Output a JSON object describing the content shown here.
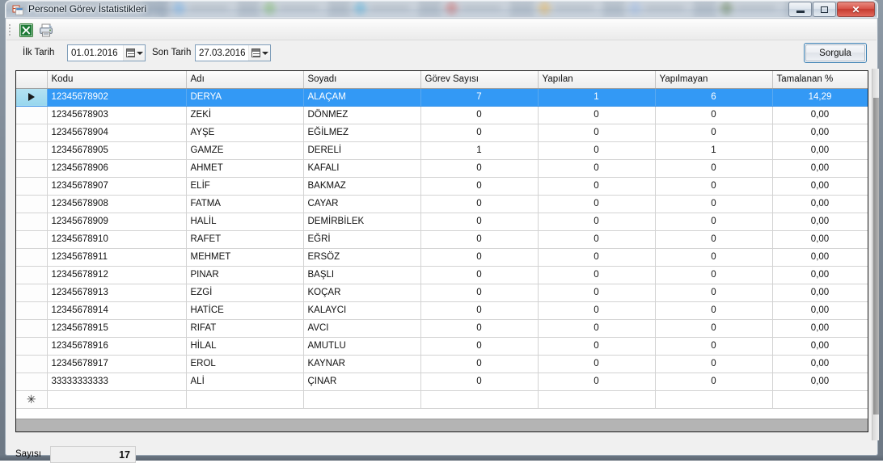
{
  "window": {
    "title": "Personel Görev İstatistikleri",
    "icon": "form-window-icon",
    "buttons": {
      "minimize": "minimize-button",
      "maximize": "maximize-button",
      "close_label": "✕"
    }
  },
  "toolbar": {
    "items": [
      {
        "name": "export-excel-icon",
        "tooltip": "Excel"
      },
      {
        "name": "print-icon",
        "tooltip": "Yazdır"
      }
    ]
  },
  "filter": {
    "start_label": "İlk Tarih",
    "start_value": "01.01.2016",
    "end_label": "Son Tarih",
    "end_value": "27.03.2016",
    "query_button": "Sorgula"
  },
  "grid": {
    "columns": [
      "Kodu",
      "Adı",
      "Soyadı",
      "Görev Sayısı",
      "Yapılan",
      "Yapılmayan",
      "Tamalanan %"
    ],
    "new_row_glyph": "✳",
    "selected_index": 0,
    "rows": [
      {
        "kodu": "12345678902",
        "adi": "DERYA",
        "soyadi": "ALAÇAM",
        "gorev": "7",
        "yapilan": "1",
        "yapilmayan": "6",
        "yuzde": "14,29"
      },
      {
        "kodu": "12345678903",
        "adi": "ZEKİ",
        "soyadi": "DÖNMEZ",
        "gorev": "0",
        "yapilan": "0",
        "yapilmayan": "0",
        "yuzde": "0,00"
      },
      {
        "kodu": "12345678904",
        "adi": "AYŞE",
        "soyadi": "EĞİLMEZ",
        "gorev": "0",
        "yapilan": "0",
        "yapilmayan": "0",
        "yuzde": "0,00"
      },
      {
        "kodu": "12345678905",
        "adi": "GAMZE",
        "soyadi": "DERELİ",
        "gorev": "1",
        "yapilan": "0",
        "yapilmayan": "1",
        "yuzde": "0,00"
      },
      {
        "kodu": "12345678906",
        "adi": "AHMET",
        "soyadi": "KAFALI",
        "gorev": "0",
        "yapilan": "0",
        "yapilmayan": "0",
        "yuzde": "0,00"
      },
      {
        "kodu": "12345678907",
        "adi": "ELİF",
        "soyadi": "BAKMAZ",
        "gorev": "0",
        "yapilan": "0",
        "yapilmayan": "0",
        "yuzde": "0,00"
      },
      {
        "kodu": "12345678908",
        "adi": "FATMA",
        "soyadi": "CAYAR",
        "gorev": "0",
        "yapilan": "0",
        "yapilmayan": "0",
        "yuzde": "0,00"
      },
      {
        "kodu": "12345678909",
        "adi": "HALİL",
        "soyadi": "DEMİRBİLEK",
        "gorev": "0",
        "yapilan": "0",
        "yapilmayan": "0",
        "yuzde": "0,00"
      },
      {
        "kodu": "12345678910",
        "adi": "RAFET",
        "soyadi": "EĞRİ",
        "gorev": "0",
        "yapilan": "0",
        "yapilmayan": "0",
        "yuzde": "0,00"
      },
      {
        "kodu": "12345678911",
        "adi": "MEHMET",
        "soyadi": "ERSÖZ",
        "gorev": "0",
        "yapilan": "0",
        "yapilmayan": "0",
        "yuzde": "0,00"
      },
      {
        "kodu": "12345678912",
        "adi": "PINAR",
        "soyadi": "BAŞLI",
        "gorev": "0",
        "yapilan": "0",
        "yapilmayan": "0",
        "yuzde": "0,00"
      },
      {
        "kodu": "12345678913",
        "adi": "EZGİ",
        "soyadi": "KOÇAR",
        "gorev": "0",
        "yapilan": "0",
        "yapilmayan": "0",
        "yuzde": "0,00"
      },
      {
        "kodu": "12345678914",
        "adi": "HATİCE",
        "soyadi": "KALAYCI",
        "gorev": "0",
        "yapilan": "0",
        "yapilmayan": "0",
        "yuzde": "0,00"
      },
      {
        "kodu": "12345678915",
        "adi": "RIFAT",
        "soyadi": "AVCI",
        "gorev": "0",
        "yapilan": "0",
        "yapilmayan": "0",
        "yuzde": "0,00"
      },
      {
        "kodu": "12345678916",
        "adi": "HİLAL",
        "soyadi": "AMUTLU",
        "gorev": "0",
        "yapilan": "0",
        "yapilmayan": "0",
        "yuzde": "0,00"
      },
      {
        "kodu": "12345678917",
        "adi": "EROL",
        "soyadi": "KAYNAR",
        "gorev": "0",
        "yapilan": "0",
        "yapilmayan": "0",
        "yuzde": "0,00"
      },
      {
        "kodu": "33333333333",
        "adi": "ALİ",
        "soyadi": "ÇINAR",
        "gorev": "0",
        "yapilan": "0",
        "yapilmayan": "0",
        "yuzde": "0,00"
      }
    ]
  },
  "footer": {
    "count_label": "Sayısı",
    "count_value": "17"
  },
  "colors": {
    "selection": "#3399f5",
    "row_header_selection": "#9dd8ef",
    "focus_border": "#3c7fb1",
    "close_button": "#c63c31"
  }
}
